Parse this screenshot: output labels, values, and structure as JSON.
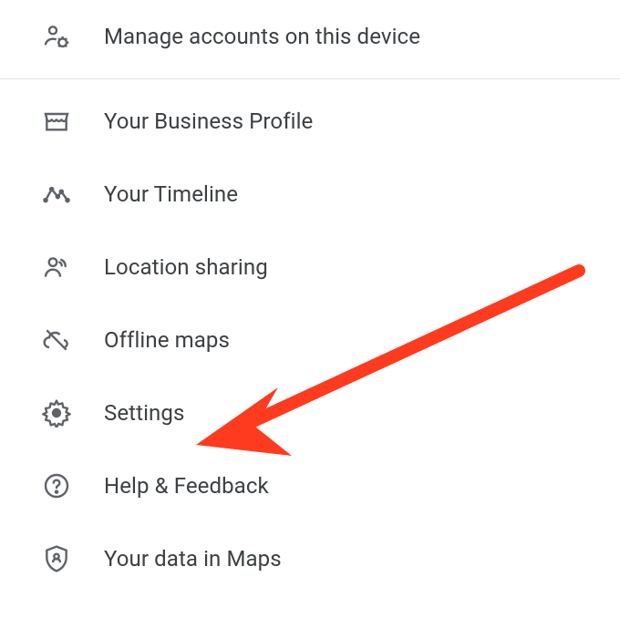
{
  "menu": {
    "items": [
      {
        "label": "Manage accounts on this device"
      },
      {
        "label": "Your Business Profile"
      },
      {
        "label": "Your Timeline"
      },
      {
        "label": "Location sharing"
      },
      {
        "label": "Offline maps"
      },
      {
        "label": "Settings"
      },
      {
        "label": "Help & Feedback"
      },
      {
        "label": "Your data in Maps"
      }
    ]
  },
  "annotation": {
    "target": "settings",
    "color": "#ff3b1f"
  }
}
